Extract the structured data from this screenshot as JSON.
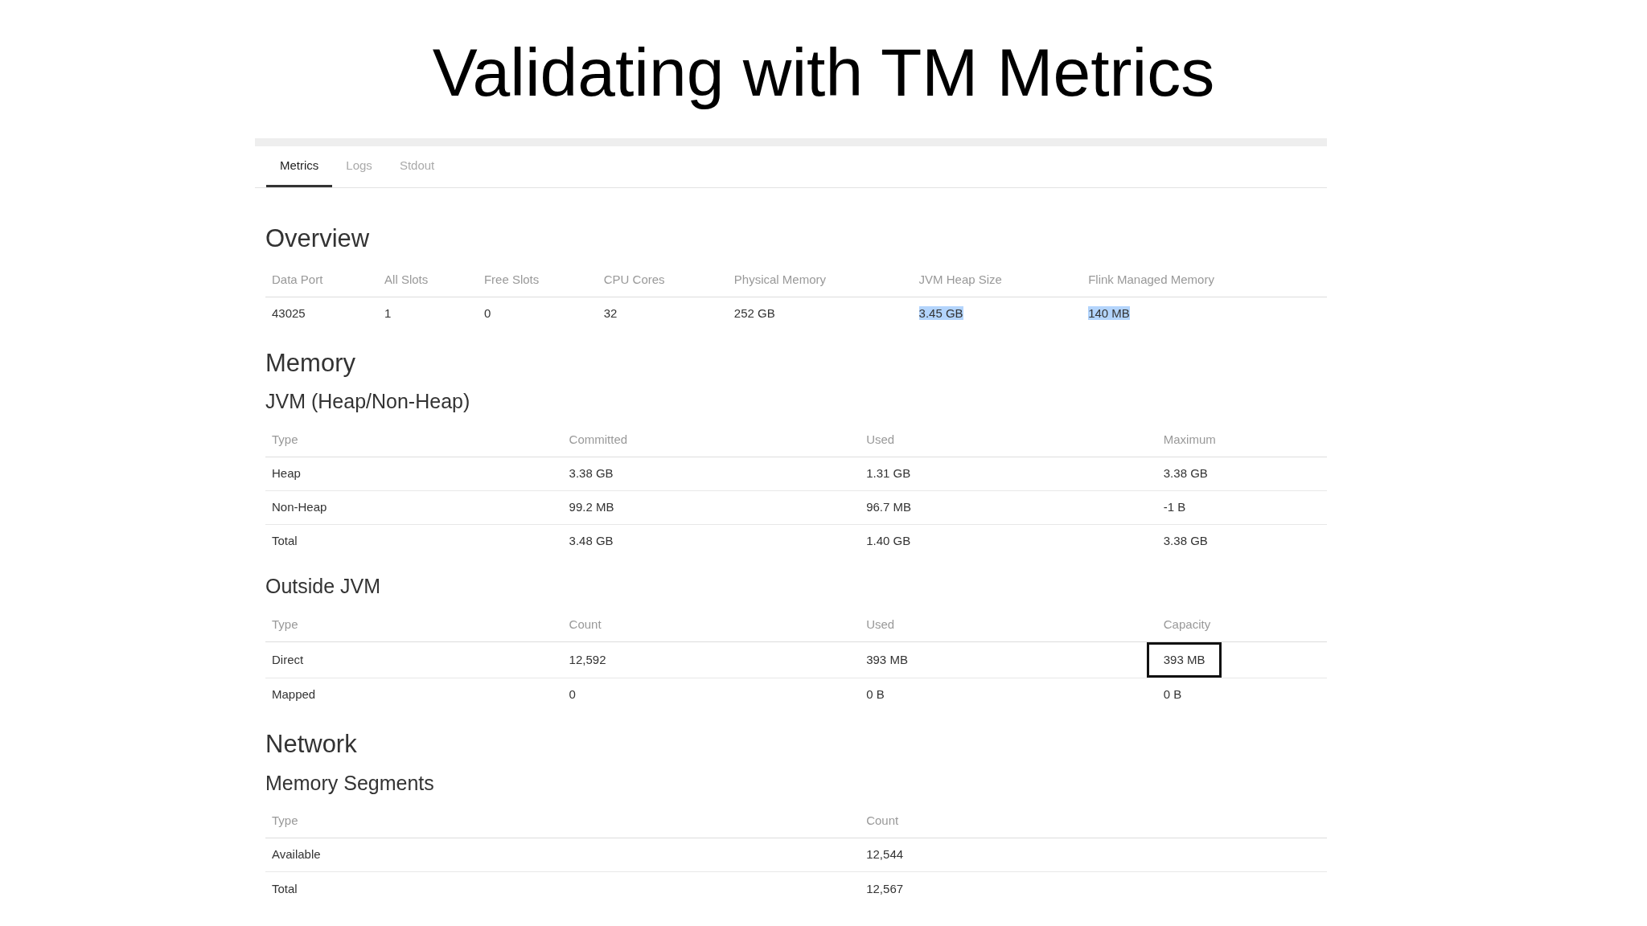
{
  "slide": {
    "title": "Validating with TM Metrics"
  },
  "tabs": [
    {
      "label": "Metrics",
      "selected": true
    },
    {
      "label": "Logs",
      "selected": false
    },
    {
      "label": "Stdout",
      "selected": false
    }
  ],
  "sections": [
    {
      "kind": "heading",
      "text": "Overview"
    },
    {
      "kind": "table",
      "columns": [
        "Data Port",
        "All Slots",
        "Free Slots",
        "CPU Cores",
        "Physical Memory",
        "JVM Heap Size",
        "Flink Managed Memory"
      ],
      "rows": [
        [
          "43025",
          "1",
          "0",
          "32",
          "252 GB",
          {
            "text": "3.45 GB",
            "highlighted": true
          },
          {
            "text": "140 MB",
            "highlighted": true
          }
        ]
      ]
    },
    {
      "kind": "heading",
      "text": "Memory"
    },
    {
      "kind": "subheading",
      "text": "JVM (Heap/Non-Heap)"
    },
    {
      "kind": "table",
      "columns": [
        "Type",
        "Committed",
        "Used",
        "Maximum"
      ],
      "rows": [
        [
          "Heap",
          "3.38 GB",
          "1.31 GB",
          "3.38 GB"
        ],
        [
          "Non-Heap",
          "99.2 MB",
          "96.7 MB",
          "-1 B"
        ],
        [
          "Total",
          "3.48 GB",
          "1.40 GB",
          "3.38 GB"
        ]
      ]
    },
    {
      "kind": "subheading",
      "text": "Outside JVM"
    },
    {
      "kind": "table",
      "columns": [
        "Type",
        "Count",
        "Used",
        "Capacity"
      ],
      "rows": [
        [
          "Direct",
          "12,592",
          "393 MB",
          {
            "text": "393 MB",
            "outlined": true
          }
        ],
        [
          "Mapped",
          "0",
          "0 B",
          "0 B"
        ]
      ]
    },
    {
      "kind": "heading",
      "text": "Network"
    },
    {
      "kind": "subheading",
      "text": "Memory Segments"
    },
    {
      "kind": "table",
      "columns": [
        "Type",
        "Count"
      ],
      "rows": [
        [
          "Available",
          "12,544"
        ],
        [
          "Total",
          "12,567"
        ]
      ]
    }
  ]
}
